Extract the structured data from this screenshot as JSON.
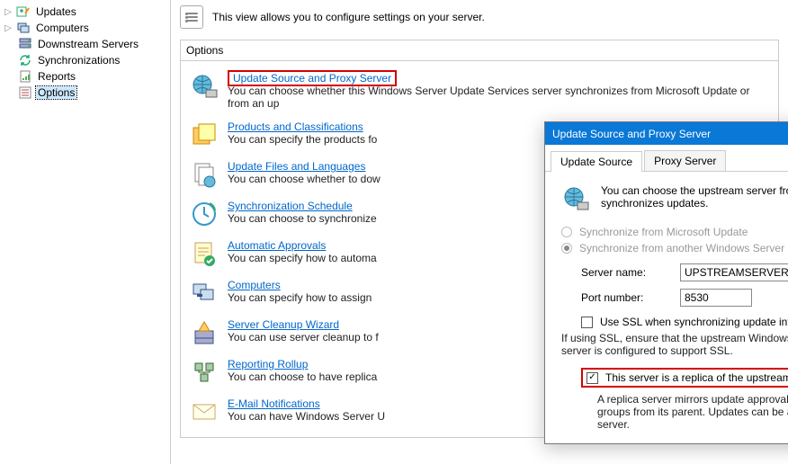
{
  "tree": {
    "items": [
      {
        "label": "Updates",
        "expander": "▷"
      },
      {
        "label": "Computers",
        "expander": "▷"
      },
      {
        "label": "Downstream Servers",
        "expander": ""
      },
      {
        "label": "Synchronizations",
        "expander": ""
      },
      {
        "label": "Reports",
        "expander": ""
      },
      {
        "label": "Options",
        "expander": ""
      }
    ]
  },
  "infobar": {
    "text": "This view allows you to configure settings on your server."
  },
  "group_header": "Options",
  "options": [
    {
      "title": "Update Source and Proxy Server",
      "desc": "You can choose whether this Windows Server Update Services server synchronizes from Microsoft Update or from an up"
    },
    {
      "title": "Products and Classifications",
      "desc": "You can specify the products fo"
    },
    {
      "title": "Update Files and Languages",
      "desc": "You can choose whether to dow"
    },
    {
      "title": "Synchronization Schedule",
      "desc": "You can choose to synchronize"
    },
    {
      "title": "Automatic Approvals",
      "desc": "You can specify how to automa"
    },
    {
      "title": "Computers",
      "desc": "You can specify how to assign "
    },
    {
      "title": "Server Cleanup Wizard",
      "desc": "You can use server cleanup to f"
    },
    {
      "title": "Reporting Rollup",
      "desc": "You can choose to have replica"
    },
    {
      "title": "E-Mail Notifications",
      "desc": "You can have Windows Server U"
    }
  ],
  "dialog": {
    "title": "Update Source and Proxy Server",
    "tabs": [
      "Update Source",
      "Proxy Server"
    ],
    "intro": "You can choose the upstream server from which your server synchronizes updates.",
    "radio1": "Synchronize from Microsoft Update",
    "radio2": "Synchronize from another Windows Server Update Services server",
    "server_label": "Server name:",
    "server_value": "UPSTREAMSERVER",
    "port_label": "Port number:",
    "port_value": "8530",
    "ssl_label": "Use SSL when synchronizing update information",
    "ssl_hint": "If using SSL, ensure that the upstream Windows Server Update Services server is configured to support SSL.",
    "replica_label": "This server is a replica of the upstream server",
    "replica_hint": "A replica server mirrors update approvals, settings, computers, and groups from its parent. Updates can be approved only on the upstream server."
  }
}
